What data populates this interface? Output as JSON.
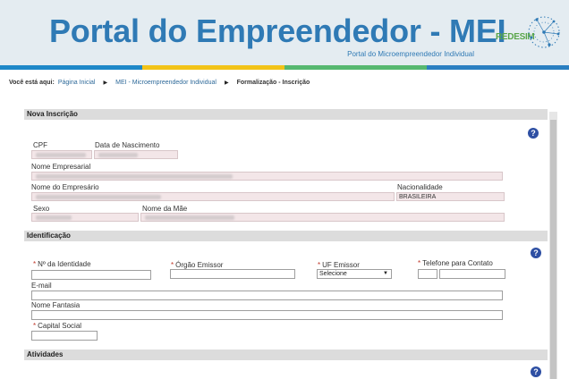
{
  "header": {
    "title": "Portal do Empreendedor - MEI",
    "subtitle": "Portal do Microempreendedor Individual",
    "logo_text": "REDESIM"
  },
  "breadcrumb": {
    "lead": "Você está aqui:",
    "items": [
      "Página Inicial",
      "MEI - Microempreendedor Individual",
      "Formalização - Inscrição"
    ]
  },
  "sections": {
    "nova_inscricao": "Nova Inscrição",
    "identificacao": "Identificação",
    "atividades": "Atividades"
  },
  "help_icon": "?",
  "nova_inscricao": {
    "cpf_label": "CPF",
    "nascimento_label": "Data de Nascimento",
    "nome_empresarial_label": "Nome Empresarial",
    "nome_empresario_label": "Nome do Empresário",
    "nacionalidade_label": "Nacionalidade",
    "nacionalidade_value": "BRASILEIRA",
    "sexo_label": "Sexo",
    "nome_mae_label": "Nome da Mãe"
  },
  "identificacao": {
    "required_mark": "*",
    "identidade_label": "Nº da Identidade",
    "orgao_label": "Órgão Emissor",
    "uf_label": "UF Emissor",
    "uf_selected": "Selecione",
    "telefone_label": "Telefone para Contato",
    "email_label": "E-mail",
    "fantasia_label": "Nome Fantasia",
    "capital_label": "Capital Social"
  },
  "colors": {
    "brand_blue": "#2f7ab5",
    "logo_green": "#5aa64a",
    "help_blue": "#2e4fa3",
    "readonly_bg": "#f3e6e8"
  }
}
